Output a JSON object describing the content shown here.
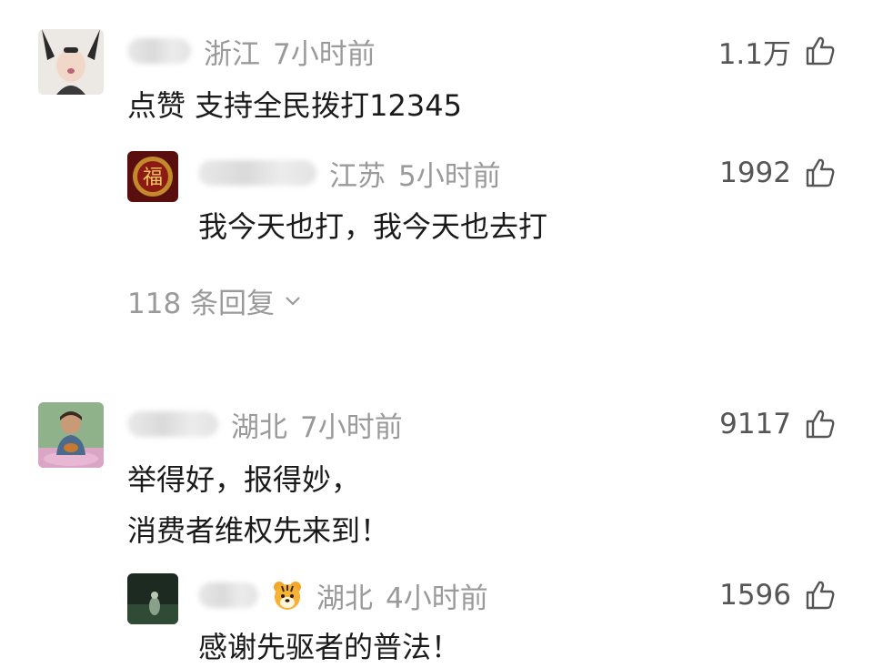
{
  "comments": [
    {
      "location": "浙江",
      "time": "7小时前",
      "likes": "1.1万",
      "text": "点赞 支持全民拨打12345",
      "reply": {
        "location": "江苏",
        "time": "5小时前",
        "likes": "1992",
        "text": "我今天也打，我今天也去打"
      },
      "replies_link": "118 条回复"
    },
    {
      "location": "湖北",
      "time": "7小时前",
      "likes": "9117",
      "text_lines": [
        "举得好，报得妙，",
        "消费者维权先来到！"
      ],
      "reply": {
        "location": "湖北",
        "time": "4小时前",
        "likes": "1596",
        "text": "感谢先驱者的普法！"
      }
    }
  ],
  "icons": {
    "like": "thumbs-up-icon",
    "expand": "chevron-down-icon",
    "emoji": "tiger-face-emoji"
  },
  "colors": {
    "meta_text": "#9a9a9a",
    "body_text": "#1a1a1a",
    "likes_text": "#555555"
  }
}
